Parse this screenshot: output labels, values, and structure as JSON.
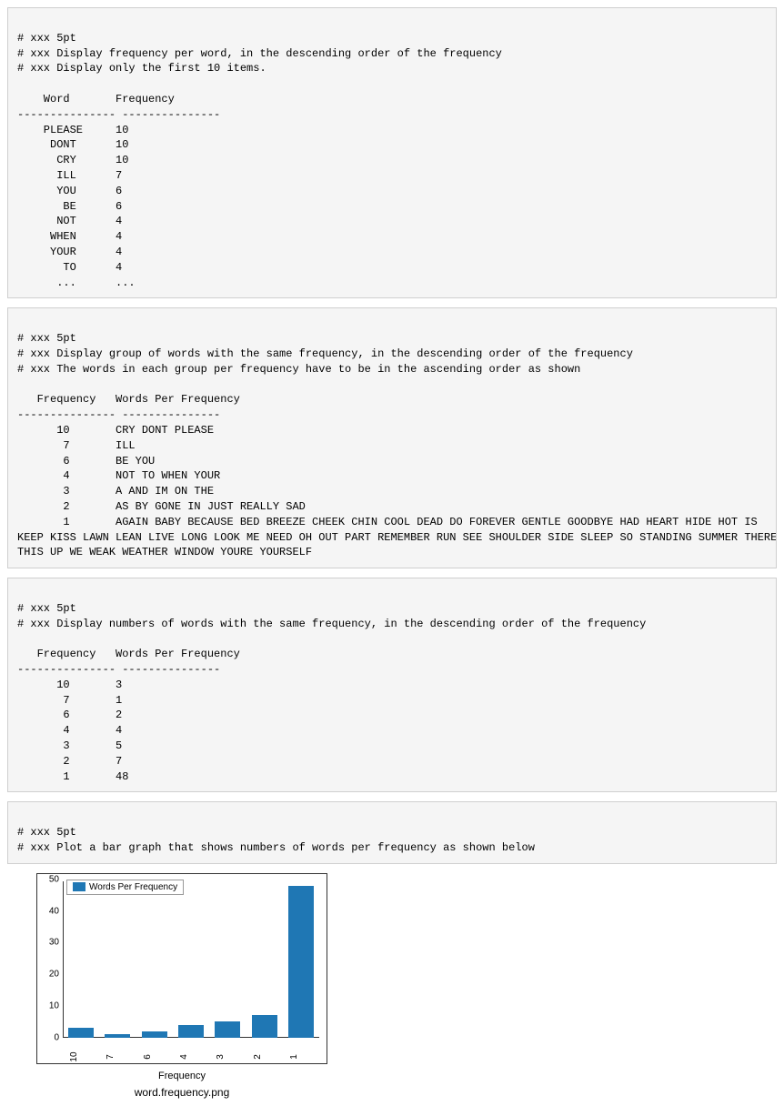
{
  "cells": {
    "cell1": {
      "comment1": "# xxx 5pt",
      "comment2": "# xxx Display frequency per word, in the descending order of the frequency",
      "comment3": "# xxx Display only the first 10 items.",
      "header1": "    Word       Frequency",
      "sep": "--------------- ---------------",
      "rows": [
        "    PLEASE     10",
        "     DONT      10",
        "      CRY      10",
        "      ILL      7",
        "      YOU      6",
        "       BE      6",
        "      NOT      4",
        "     WHEN      4",
        "     YOUR      4",
        "       TO      4",
        "      ...      ..."
      ]
    },
    "cell2": {
      "comment1": "# xxx 5pt",
      "comment2": "# xxx Display group of words with the same frequency, in the descending order of the frequency",
      "comment3": "# xxx The words in each group per frequency have to be in the ascending order as shown",
      "header1": "   Frequency   Words Per Frequency",
      "sep": "--------------- ---------------",
      "rows": [
        "      10       CRY DONT PLEASE",
        "       7       ILL",
        "       6       BE YOU",
        "       4       NOT TO WHEN YOUR",
        "       3       A AND IM ON THE",
        "       2       AS BY GONE IN JUST REALLY SAD",
        "       1       AGAIN BABY BECAUSE BED BREEZE CHEEK CHIN COOL DEAD DO FOREVER GENTLE GOODBYE HAD HEART HIDE HOT IS\nKEEP KISS LAWN LEAN LIVE LONG LOOK ME NEED OH OUT PART REMEMBER RUN SEE SHOULDER SIDE SLEEP SO STANDING SUMMER THERE\nTHIS UP WE WEAK WEATHER WINDOW YOURE YOURSELF"
      ]
    },
    "cell3": {
      "comment1": "# xxx 5pt",
      "comment2": "# xxx Display numbers of words with the same frequency, in the descending order of the frequency",
      "header1": "   Frequency   Words Per Frequency",
      "sep": "--------------- ---------------",
      "rows": [
        "      10       3",
        "       7       1",
        "       6       2",
        "       4       4",
        "       3       5",
        "       2       7",
        "       1       48"
      ]
    },
    "cell4": {
      "comment1": "# xxx 5pt",
      "comment2": "# xxx Plot a bar graph that shows numbers of words per frequency as shown below"
    }
  },
  "chart_data": {
    "type": "bar",
    "categories": [
      "10",
      "7",
      "6",
      "4",
      "3",
      "2",
      "1"
    ],
    "values": [
      3,
      1,
      2,
      4,
      5,
      7,
      48
    ],
    "title": "",
    "xlabel": "Frequency",
    "ylabel": "",
    "ylim": [
      0,
      50
    ],
    "yticks": [
      0,
      10,
      20,
      30,
      40,
      50
    ],
    "legend": "Words Per Frequency",
    "color": "#1f77b4"
  },
  "caption": "word.frequency.png"
}
